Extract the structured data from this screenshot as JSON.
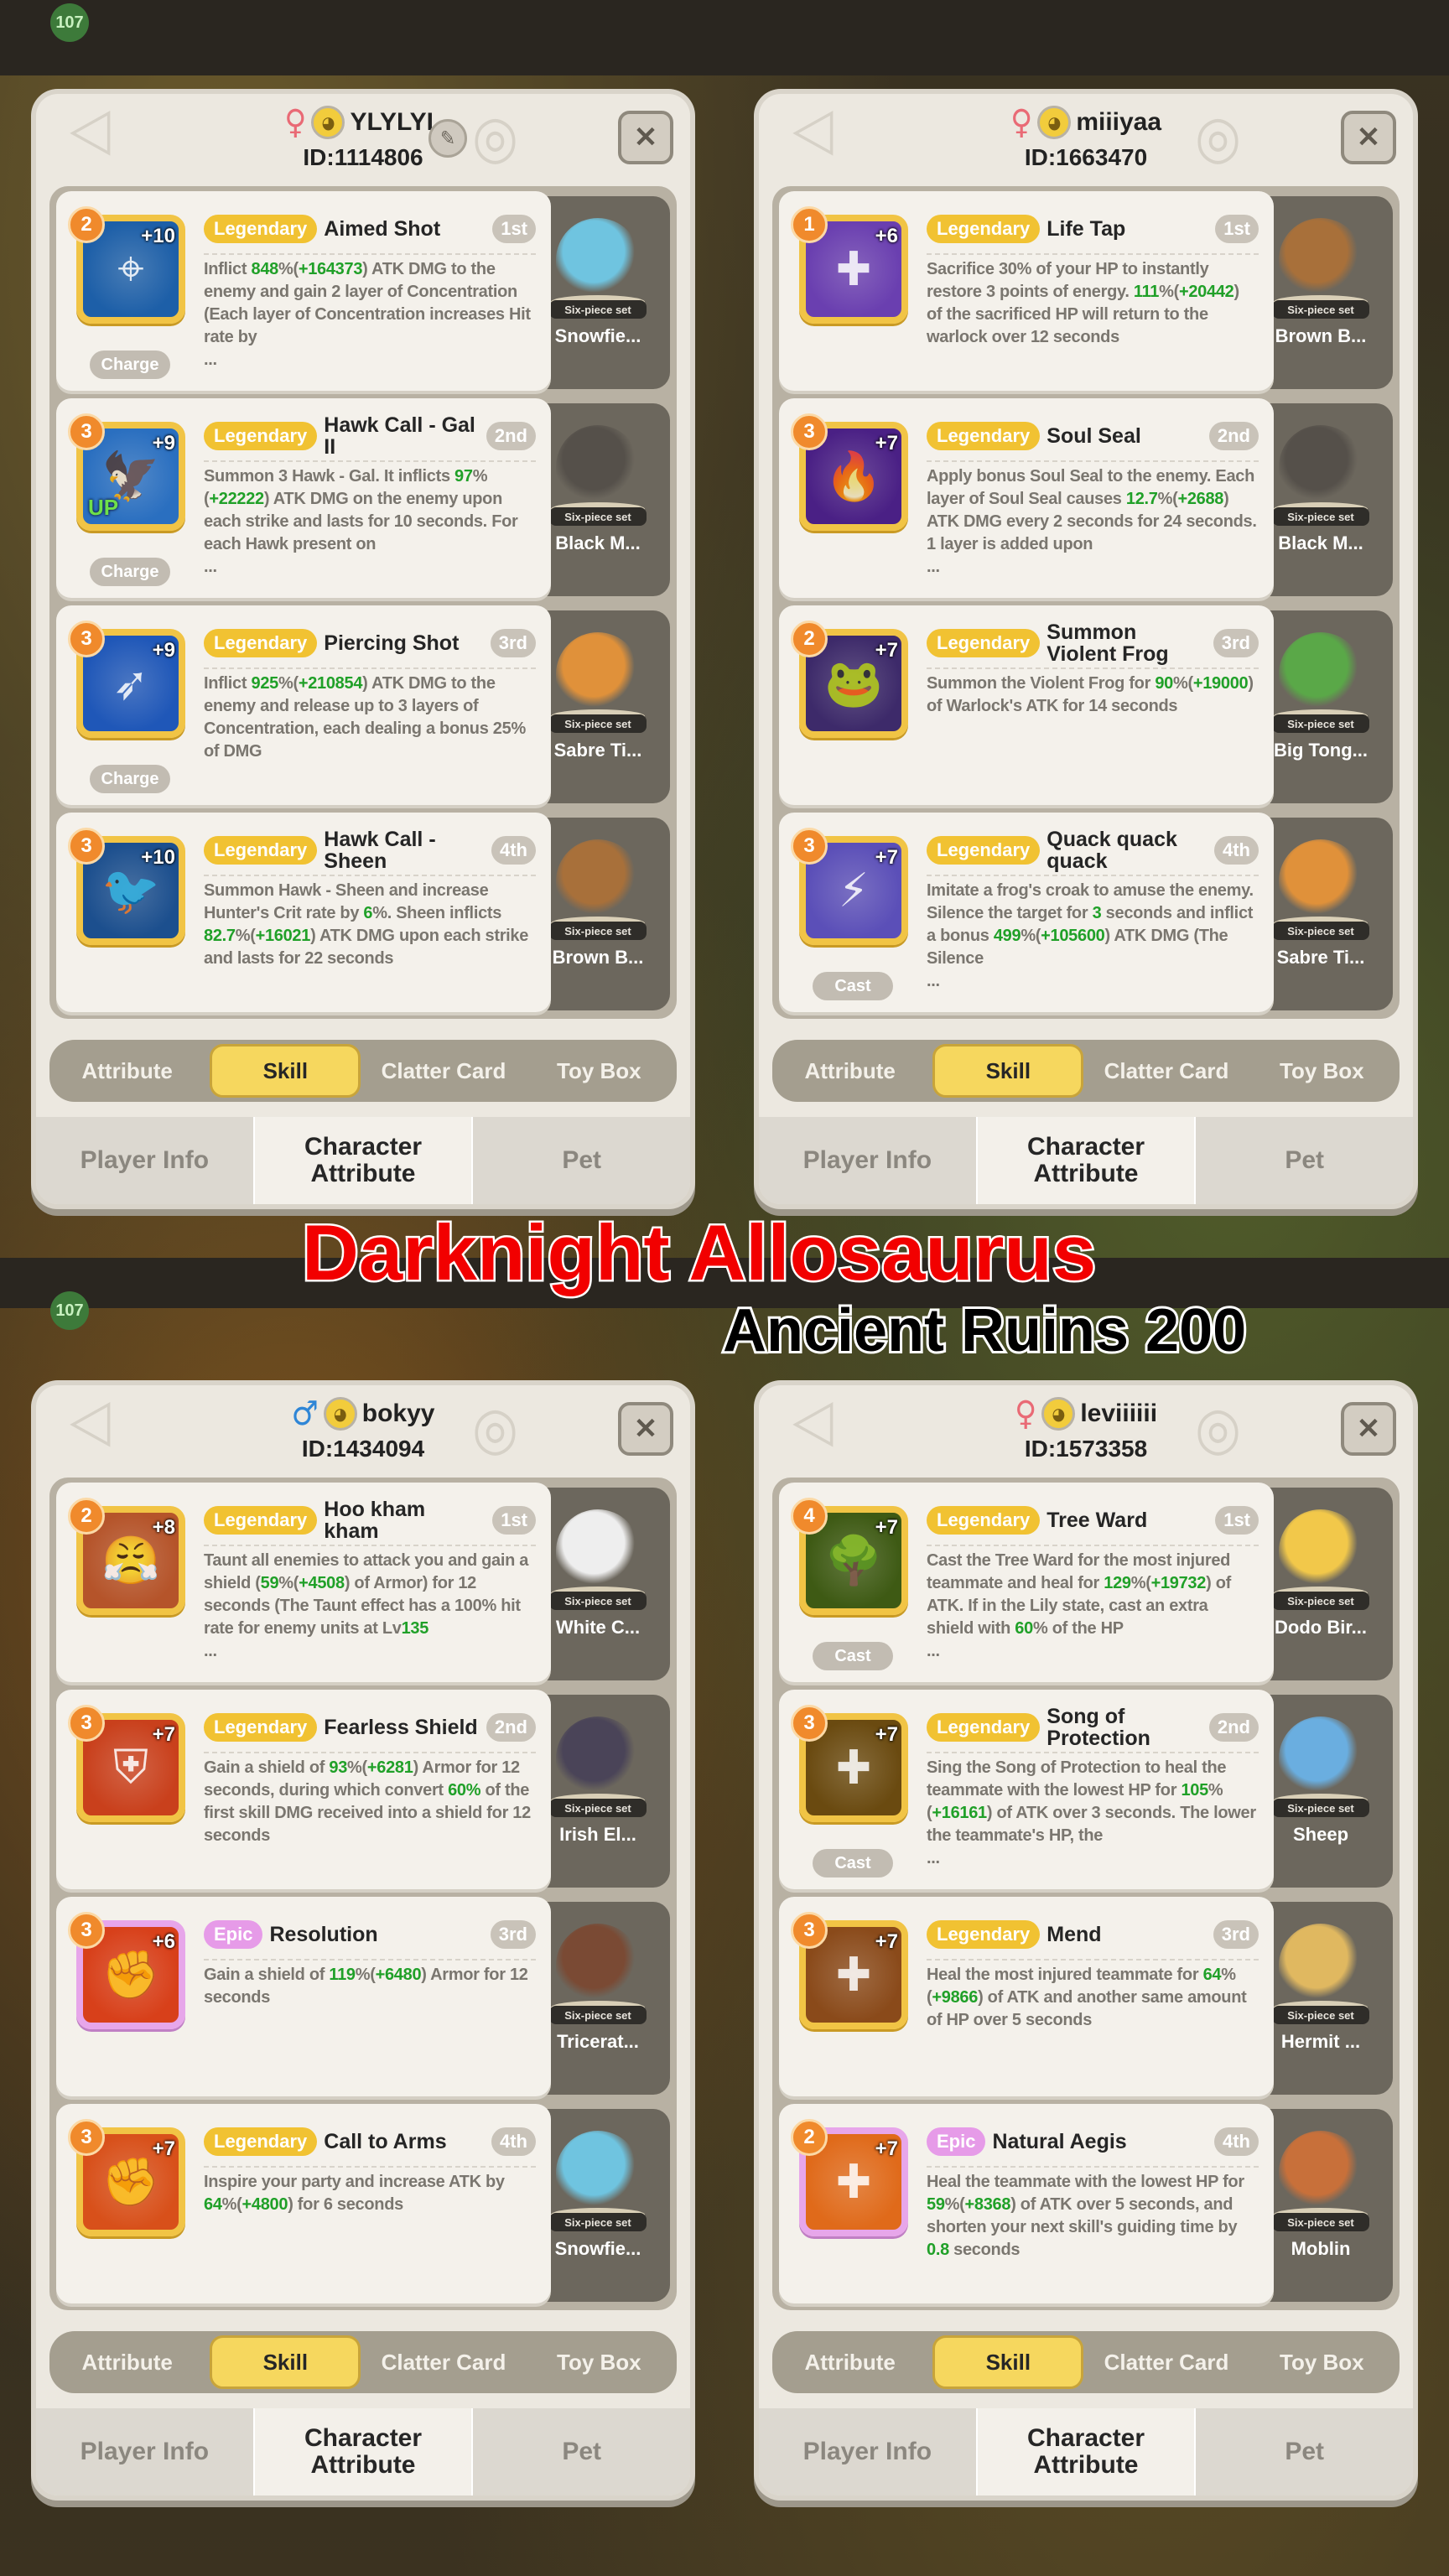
{
  "background": {
    "level_badge": "107"
  },
  "banner": {
    "title": "Darknight Allosaurus",
    "subtitle": "Ancient Ruins 200",
    "title_color": "#f20000"
  },
  "labels": {
    "six_piece_set": "Six-piece set",
    "close_icon": "✕",
    "edit_icon": "✎"
  },
  "colors": {
    "legendary": "#f1c232",
    "epic": "#e69be8",
    "highlight": "#20a028",
    "female": "#e96a75",
    "male": "#2f86d6"
  },
  "subtabs": [
    {
      "label": "Attribute"
    },
    {
      "label": "Skill",
      "active": true
    },
    {
      "label": "Clatter Card"
    },
    {
      "label": "Toy Box"
    }
  ],
  "bottom_tabs": [
    {
      "label": "Player Info"
    },
    {
      "label": "Character Attribute",
      "active": true
    },
    {
      "label": "Pet"
    }
  ],
  "panels": [
    {
      "gender": "female",
      "gender_icon": "♀",
      "username": "YLYLYL",
      "id": "ID:1114806",
      "editable": true,
      "skills": [
        {
          "level": "2",
          "plus": "+10",
          "rarity": "Legendary",
          "name": "Aimed Shot",
          "rank": "1st",
          "tag": "Charge",
          "icon_color": "#1d5fa8",
          "icon": "target-icon",
          "glyph": "⌖",
          "desc": [
            {
              "t": "Inflict "
            },
            {
              "t": "848",
              "g": true
            },
            {
              "t": "%("
            },
            {
              "t": "+164373",
              "g": true
            },
            {
              "t": ") ATK DMG to the enemy and gain 2 layer of Concentration (Each layer of Concentration increases Hit rate by"
            }
          ],
          "ellipsis": "...",
          "pet": "Snowfie...",
          "pet_color": "#6fc4e0"
        },
        {
          "level": "3",
          "plus": "+9",
          "up": "UP",
          "rarity": "Legendary",
          "name": "Hawk Call - Gal II",
          "rank": "2nd",
          "tag": "Charge",
          "icon_color": "#2a6fc0",
          "icon": "hawk-icon",
          "glyph": "🦅",
          "desc": [
            {
              "t": "Summon 3 Hawk - Gal. It inflicts "
            },
            {
              "t": "97",
              "g": true
            },
            {
              "t": "%("
            },
            {
              "t": "+22222",
              "g": true
            },
            {
              "t": ") ATK DMG on the enemy upon each strike and lasts for 10 seconds. For each Hawk present on"
            }
          ],
          "ellipsis": "...",
          "pet": "Black M...",
          "pet_color": "#55504a"
        },
        {
          "level": "3",
          "plus": "+9",
          "rarity": "Legendary",
          "name": "Piercing Shot",
          "rank": "3rd",
          "tag": "Charge",
          "icon_color": "#1f57b8",
          "icon": "arrow-icon",
          "glyph": "➶",
          "desc": [
            {
              "t": "Inflict "
            },
            {
              "t": "925",
              "g": true
            },
            {
              "t": "%("
            },
            {
              "t": "+210854",
              "g": true
            },
            {
              "t": ") ATK DMG to the enemy and release up to 3 layers of Concentration, each dealing a bonus 25% of DMG"
            }
          ],
          "pet": "Sabre Ti...",
          "pet_color": "#e0913a"
        },
        {
          "level": "3",
          "plus": "+10",
          "rarity": "Legendary",
          "name": "Hawk Call - Sheen",
          "rank": "4th",
          "icon_color": "#1c4f8e",
          "icon": "dark-hawk-icon",
          "glyph": "🐦",
          "desc": [
            {
              "t": "Summon Hawk - Sheen and increase Hunter's Crit rate by "
            },
            {
              "t": "6",
              "g": true
            },
            {
              "t": "%. Sheen inflicts "
            },
            {
              "t": "82.7",
              "g": true
            },
            {
              "t": "%("
            },
            {
              "t": "+16021",
              "g": true
            },
            {
              "t": ") ATK DMG upon each strike and lasts for 22 seconds"
            }
          ],
          "pet": "Brown B...",
          "pet_color": "#a8703a"
        }
      ]
    },
    {
      "gender": "female",
      "gender_icon": "♀",
      "username": "miiiyaa",
      "id": "ID:1663470",
      "editable": false,
      "skills": [
        {
          "level": "1",
          "plus": "+6",
          "rarity": "Legendary",
          "name": "Life Tap",
          "rank": "1st",
          "icon_color": "#6a3fb0",
          "icon": "cross-icon",
          "glyph": "✚",
          "desc": [
            {
              "t": "Sacrifice 30% of your HP to instantly restore 3 points of energy. "
            },
            {
              "t": "111",
              "g": true
            },
            {
              "t": "%("
            },
            {
              "t": "+20442",
              "g": true
            },
            {
              "t": ") of the sacrificed HP will return to the warlock over 12 seconds"
            }
          ],
          "pet": "Brown B...",
          "pet_color": "#a8703a"
        },
        {
          "level": "3",
          "plus": "+7",
          "rarity": "Legendary",
          "name": "Soul Seal",
          "rank": "2nd",
          "icon_color": "#4a2085",
          "icon": "flame-icon",
          "glyph": "🔥",
          "desc": [
            {
              "t": "Apply bonus Soul Seal to the enemy. Each layer of Soul Seal causes "
            },
            {
              "t": "12.7",
              "g": true
            },
            {
              "t": "%("
            },
            {
              "t": "+2688",
              "g": true
            },
            {
              "t": ") ATK DMG every 2 seconds for 24 seconds. 1 layer is added upon"
            }
          ],
          "ellipsis": "...",
          "pet": "Black M...",
          "pet_color": "#55504a"
        },
        {
          "level": "2",
          "plus": "+7",
          "rarity": "Legendary",
          "name": "Summon Violent Frog",
          "rank": "3rd",
          "icon_color": "#3d2a6a",
          "icon": "frog-icon",
          "glyph": "🐸",
          "desc": [
            {
              "t": "Summon the Violent Frog for "
            },
            {
              "t": "90",
              "g": true
            },
            {
              "t": "%("
            },
            {
              "t": "+19000",
              "g": true
            },
            {
              "t": ") of Warlock's ATK for 14 seconds"
            }
          ],
          "pet": "Big Tong...",
          "pet_color": "#5aa848"
        },
        {
          "level": "3",
          "plus": "+7",
          "rarity": "Legendary",
          "name": "Quack quack quack",
          "rank": "4th",
          "tag": "Cast",
          "icon_color": "#5b4fb8",
          "icon": "lightning-icon",
          "glyph": "⚡",
          "desc": [
            {
              "t": "Imitate a frog's croak to amuse the enemy. Silence the target for "
            },
            {
              "t": "3",
              "g": true
            },
            {
              "t": " seconds and inflict a bonus "
            },
            {
              "t": "499",
              "g": true
            },
            {
              "t": "%("
            },
            {
              "t": "+105600",
              "g": true
            },
            {
              "t": ") ATK DMG (The Silence"
            }
          ],
          "ellipsis": "...",
          "pet": "Sabre Ti...",
          "pet_color": "#e0913a"
        }
      ]
    },
    {
      "gender": "male",
      "gender_icon": "♂",
      "username": "bokyy",
      "id": "ID:1434094",
      "editable": false,
      "skills": [
        {
          "level": "2",
          "plus": "+8",
          "rarity": "Legendary",
          "name": "Hoo kham kham",
          "rank": "1st",
          "icon_color": "#b5542a",
          "icon": "taunt-icon",
          "glyph": "😤",
          "desc": [
            {
              "t": "Taunt all enemies to attack you and gain a shield ("
            },
            {
              "t": "59",
              "g": true
            },
            {
              "t": "%("
            },
            {
              "t": "+4508",
              "g": true
            },
            {
              "t": ") of Armor) for 12 seconds (The Taunt effect has a 100% hit rate for enemy units at Lv"
            },
            {
              "t": "135",
              "g": true
            }
          ],
          "ellipsis": "...",
          "pet": "White C...",
          "pet_color": "#eeeeee"
        },
        {
          "level": "3",
          "plus": "+7",
          "rarity": "Legendary",
          "name": "Fearless Shield",
          "rank": "2nd",
          "icon_color": "#c9401c",
          "icon": "shield-icon",
          "glyph": "⛨",
          "desc": [
            {
              "t": "Gain a shield of "
            },
            {
              "t": "93",
              "g": true
            },
            {
              "t": "%("
            },
            {
              "t": "+6281",
              "g": true
            },
            {
              "t": ") Armor for 12 seconds, during which convert "
            },
            {
              "t": "60%",
              "g": true
            },
            {
              "t": " of the first skill DMG received into a shield for 12 seconds"
            }
          ],
          "pet": "Irish El...",
          "pet_color": "#4a4458"
        },
        {
          "level": "3",
          "plus": "+6",
          "rarity": "Epic",
          "name": "Resolution",
          "rank": "3rd",
          "icon_color": "#d8401a",
          "icon": "fist-icon",
          "glyph": "✊",
          "desc": [
            {
              "t": "Gain a shield of "
            },
            {
              "t": "119",
              "g": true
            },
            {
              "t": "%("
            },
            {
              "t": "+6480",
              "g": true
            },
            {
              "t": ") Armor for 12 seconds"
            }
          ],
          "pet": "Tricerat...",
          "pet_color": "#7a4a34"
        },
        {
          "level": "3",
          "plus": "+7",
          "rarity": "Legendary",
          "name": "Call to Arms",
          "rank": "4th",
          "icon_color": "#d8501a",
          "icon": "rally-icon",
          "glyph": "✊",
          "desc": [
            {
              "t": "Inspire your party and increase ATK by "
            },
            {
              "t": "64",
              "g": true
            },
            {
              "t": "%("
            },
            {
              "t": "+4800",
              "g": true
            },
            {
              "t": ") for 6 seconds"
            }
          ],
          "pet": "Snowfie...",
          "pet_color": "#6fc4e0"
        }
      ]
    },
    {
      "gender": "female",
      "gender_icon": "♀",
      "username": "leviiiiii",
      "id": "ID:1573358",
      "editable": false,
      "skills": [
        {
          "level": "4",
          "plus": "+7",
          "rarity": "Legendary",
          "name": "Tree Ward",
          "rank": "1st",
          "tag": "Cast",
          "icon_color": "#3e5a14",
          "icon": "tree-icon",
          "glyph": "🌳",
          "desc": [
            {
              "t": "Cast the Tree Ward for the most injured teammate and heal for "
            },
            {
              "t": "129",
              "g": true
            },
            {
              "t": "%("
            },
            {
              "t": "+19732",
              "g": true
            },
            {
              "t": ") of ATK. If in the Lily state, cast an extra shield with "
            },
            {
              "t": "60",
              "g": true
            },
            {
              "t": "% of the HP"
            }
          ],
          "ellipsis": "...",
          "pet": "Dodo Bir...",
          "pet_color": "#f2c84a"
        },
        {
          "level": "3",
          "plus": "+7",
          "rarity": "Legendary",
          "name": "Song of Protection",
          "rank": "2nd",
          "tag": "Cast",
          "icon_color": "#6a4a10",
          "icon": "holy-shield-icon",
          "glyph": "✚",
          "desc": [
            {
              "t": "Sing the Song of Protection to heal the teammate with the lowest HP for "
            },
            {
              "t": "105",
              "g": true
            },
            {
              "t": "%("
            },
            {
              "t": "+16161",
              "g": true
            },
            {
              "t": ") of ATK over 3 seconds. The lower the teammate's HP, the"
            }
          ],
          "ellipsis": "...",
          "pet": "Sheep",
          "pet_color": "#6aaee0"
        },
        {
          "level": "3",
          "plus": "+7",
          "rarity": "Legendary",
          "name": "Mend",
          "rank": "3rd",
          "icon_color": "#8a4a1a",
          "icon": "heal-icon",
          "glyph": "✚",
          "desc": [
            {
              "t": "Heal the most injured teammate for "
            },
            {
              "t": "64",
              "g": true
            },
            {
              "t": "%("
            },
            {
              "t": "+9866",
              "g": true
            },
            {
              "t": ") of ATK and another same amount of HP over 5 seconds"
            }
          ],
          "pet": "Hermit ...",
          "pet_color": "#e0b860"
        },
        {
          "level": "2",
          "plus": "+7",
          "rarity": "Epic",
          "name": "Natural Aegis",
          "rank": "4th",
          "icon_color": "#e06a1a",
          "icon": "aegis-icon",
          "glyph": "✚",
          "desc": [
            {
              "t": "Heal the teammate with the lowest HP for "
            },
            {
              "t": "59",
              "g": true
            },
            {
              "t": "%("
            },
            {
              "t": "+8368",
              "g": true
            },
            {
              "t": ") of ATK over 5 seconds, and shorten your next skill's guiding time by "
            },
            {
              "t": "0.8",
              "g": true
            },
            {
              "t": " seconds"
            }
          ],
          "pet": "Moblin",
          "pet_color": "#c8703a"
        }
      ]
    }
  ]
}
